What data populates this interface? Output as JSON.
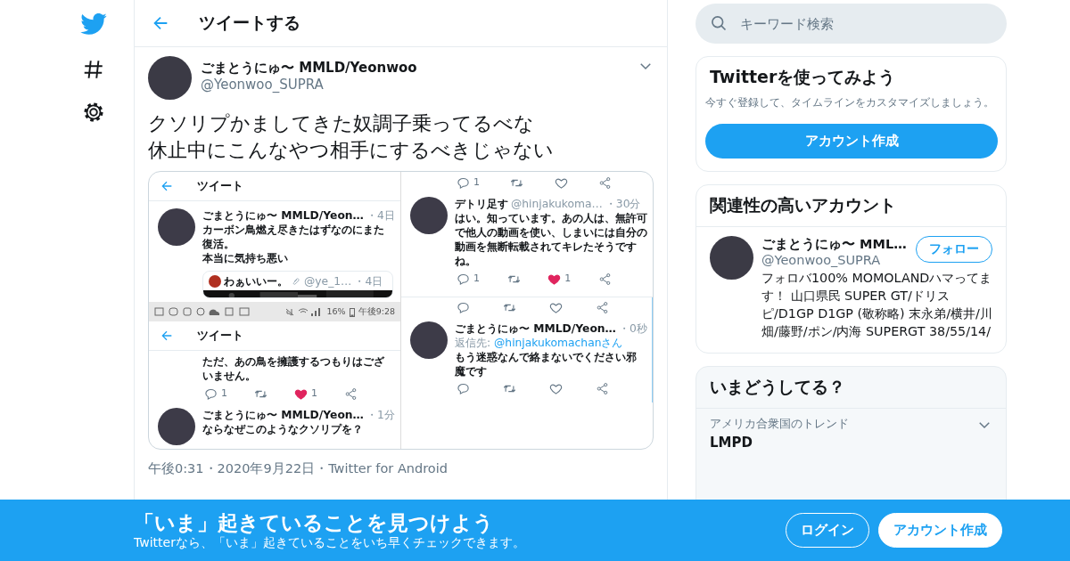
{
  "header": {
    "title": "ツイートする"
  },
  "tweet": {
    "name": "ごまとうにゅ〜 MMLD/Yeonwoo",
    "handle": "@Yeonwoo_SUPRA",
    "lines": [
      "クソリプかましてきた奴調子乗ってるべな",
      "休止中にこんなやつ相手にするべきじゃない"
    ],
    "screenshot": {
      "columns": [
        {
          "panels": [
            {
              "kind": "screen",
              "items": [
                {
                  "kind": "header",
                  "title": "ツイート"
                },
                {
                  "kind": "tweet",
                  "name": "ごまとうにゅ〜 MMLD/Yeon…",
                  "meta": "・4日",
                  "lines": [
                    "カーボン鳥燃え尽きたはずなのにまた復活。",
                    "本当に気持ち悪い"
                  ]
                },
                {
                  "kind": "quote",
                  "name": "わぁいいー。",
                  "handle": "@ye_1…",
                  "meta": "・4日"
                }
              ]
            },
            {
              "kind": "status_bar",
              "battery": "16%",
              "time": "午後9:28"
            },
            {
              "kind": "screen",
              "items": [
                {
                  "kind": "header",
                  "title": "ツイート"
                },
                {
                  "kind": "text",
                  "text": "ただ、あの鳥を擁護するつもりはございません。"
                },
                {
                  "kind": "actions",
                  "reply": "1",
                  "like": "1",
                  "liked": true
                },
                {
                  "kind": "tweet",
                  "name": "ごまとうにゅ〜 MMLD/Yeon…",
                  "meta": "・1分",
                  "lines": [
                    "ならなぜこのようなクソリプを？"
                  ]
                }
              ]
            }
          ]
        },
        {
          "panels": [
            {
              "kind": "screen",
              "items": [
                {
                  "kind": "actions",
                  "reply": "1",
                  "liked": false
                },
                {
                  "kind": "tweet",
                  "name": "デトリ足す",
                  "handle": "@hinjakukoma…",
                  "meta": "・30分",
                  "lines": [
                    "はい。知っています。あの人は、無許可で他人の動画を使い、しまいには自分の動画を無断転載されてキレたそうですね。"
                  ]
                },
                {
                  "kind": "actions",
                  "reply": "1",
                  "like": "1",
                  "liked": true
                }
              ]
            },
            {
              "kind": "screen",
              "items": [
                {
                  "kind": "actions",
                  "liked": false
                },
                {
                  "kind": "tweet",
                  "name": "ごまとうにゅ〜 MMLD/Yeon…",
                  "meta": "・0秒",
                  "reply_label": "返信先: ",
                  "mention": "@hinjakukomachanさん",
                  "lines": [
                    "もう迷惑なんで絡まないでください邪魔です"
                  ]
                },
                {
                  "kind": "actions",
                  "liked": false
                }
              ]
            }
          ]
        }
      ]
    },
    "meta": "午後0:31・2020年9月22日・Twitter for Android"
  },
  "search": {
    "placeholder": "キーワード検索"
  },
  "signup_card": {
    "title": "Twitterを使ってみよう",
    "text": "今すぐ登録して、タイムラインをカスタマイズしましょう。",
    "button": "アカウント作成"
  },
  "related": {
    "title": "関連性の高いアカウント",
    "accounts": [
      {
        "name": "ごまとうにゅ〜 MML…",
        "handle": "@Yeonwoo_SUPRA",
        "button": "フォロー",
        "bio": "フォロバ100% MOMOLANDハマってます！ 山口県民 SUPER GT/ドリスピ/D1GP D1GP (敬称略) 末永弟/横井/川畑/藤野/ポン/内海 SUPERGT 38/55/14/"
      }
    ]
  },
  "trends": {
    "title": "いまどうしてる？",
    "items": [
      {
        "context": "アメリカ合衆国のトレンド",
        "name": "LMPD"
      }
    ]
  },
  "banner": {
    "title": "「いま」起きていることを見つけよう",
    "subtitle": "Twitterなら、「いま」起きていることをいち早くチェックできます。",
    "buttons": [
      {
        "label": "ログイン",
        "kind": "outline"
      },
      {
        "label": "アカウント作成",
        "kind": "filled"
      }
    ]
  }
}
